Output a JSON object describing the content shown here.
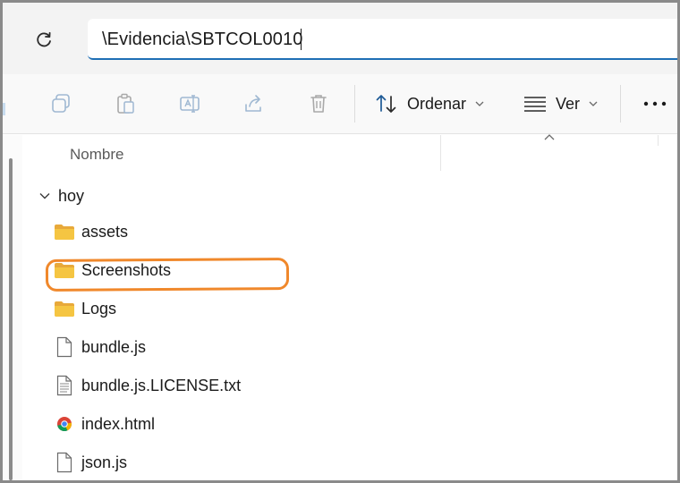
{
  "address_bar": {
    "path": "\\Evidencia\\SBTCOL0010"
  },
  "toolbar": {
    "icons": [
      "copy-icon",
      "paste-icon",
      "rename-icon",
      "share-icon",
      "delete-icon"
    ],
    "sort_label": "Ordenar",
    "view_label": "Ver",
    "more_label": "•••"
  },
  "list": {
    "column_name": "Nombre",
    "group_label": "hoy",
    "items": [
      {
        "name": "assets",
        "type": "folder"
      },
      {
        "name": "Screenshots",
        "type": "folder"
      },
      {
        "name": "Logs",
        "type": "folder"
      },
      {
        "name": "bundle.js",
        "type": "file"
      },
      {
        "name": "bundle.js.LICENSE.txt",
        "type": "text-file"
      },
      {
        "name": "index.html",
        "type": "html-file"
      },
      {
        "name": "json.js",
        "type": "file"
      }
    ]
  },
  "colors": {
    "accent": "#1f6fb5",
    "highlight": "#f0882b",
    "folder": "#f5c542"
  }
}
